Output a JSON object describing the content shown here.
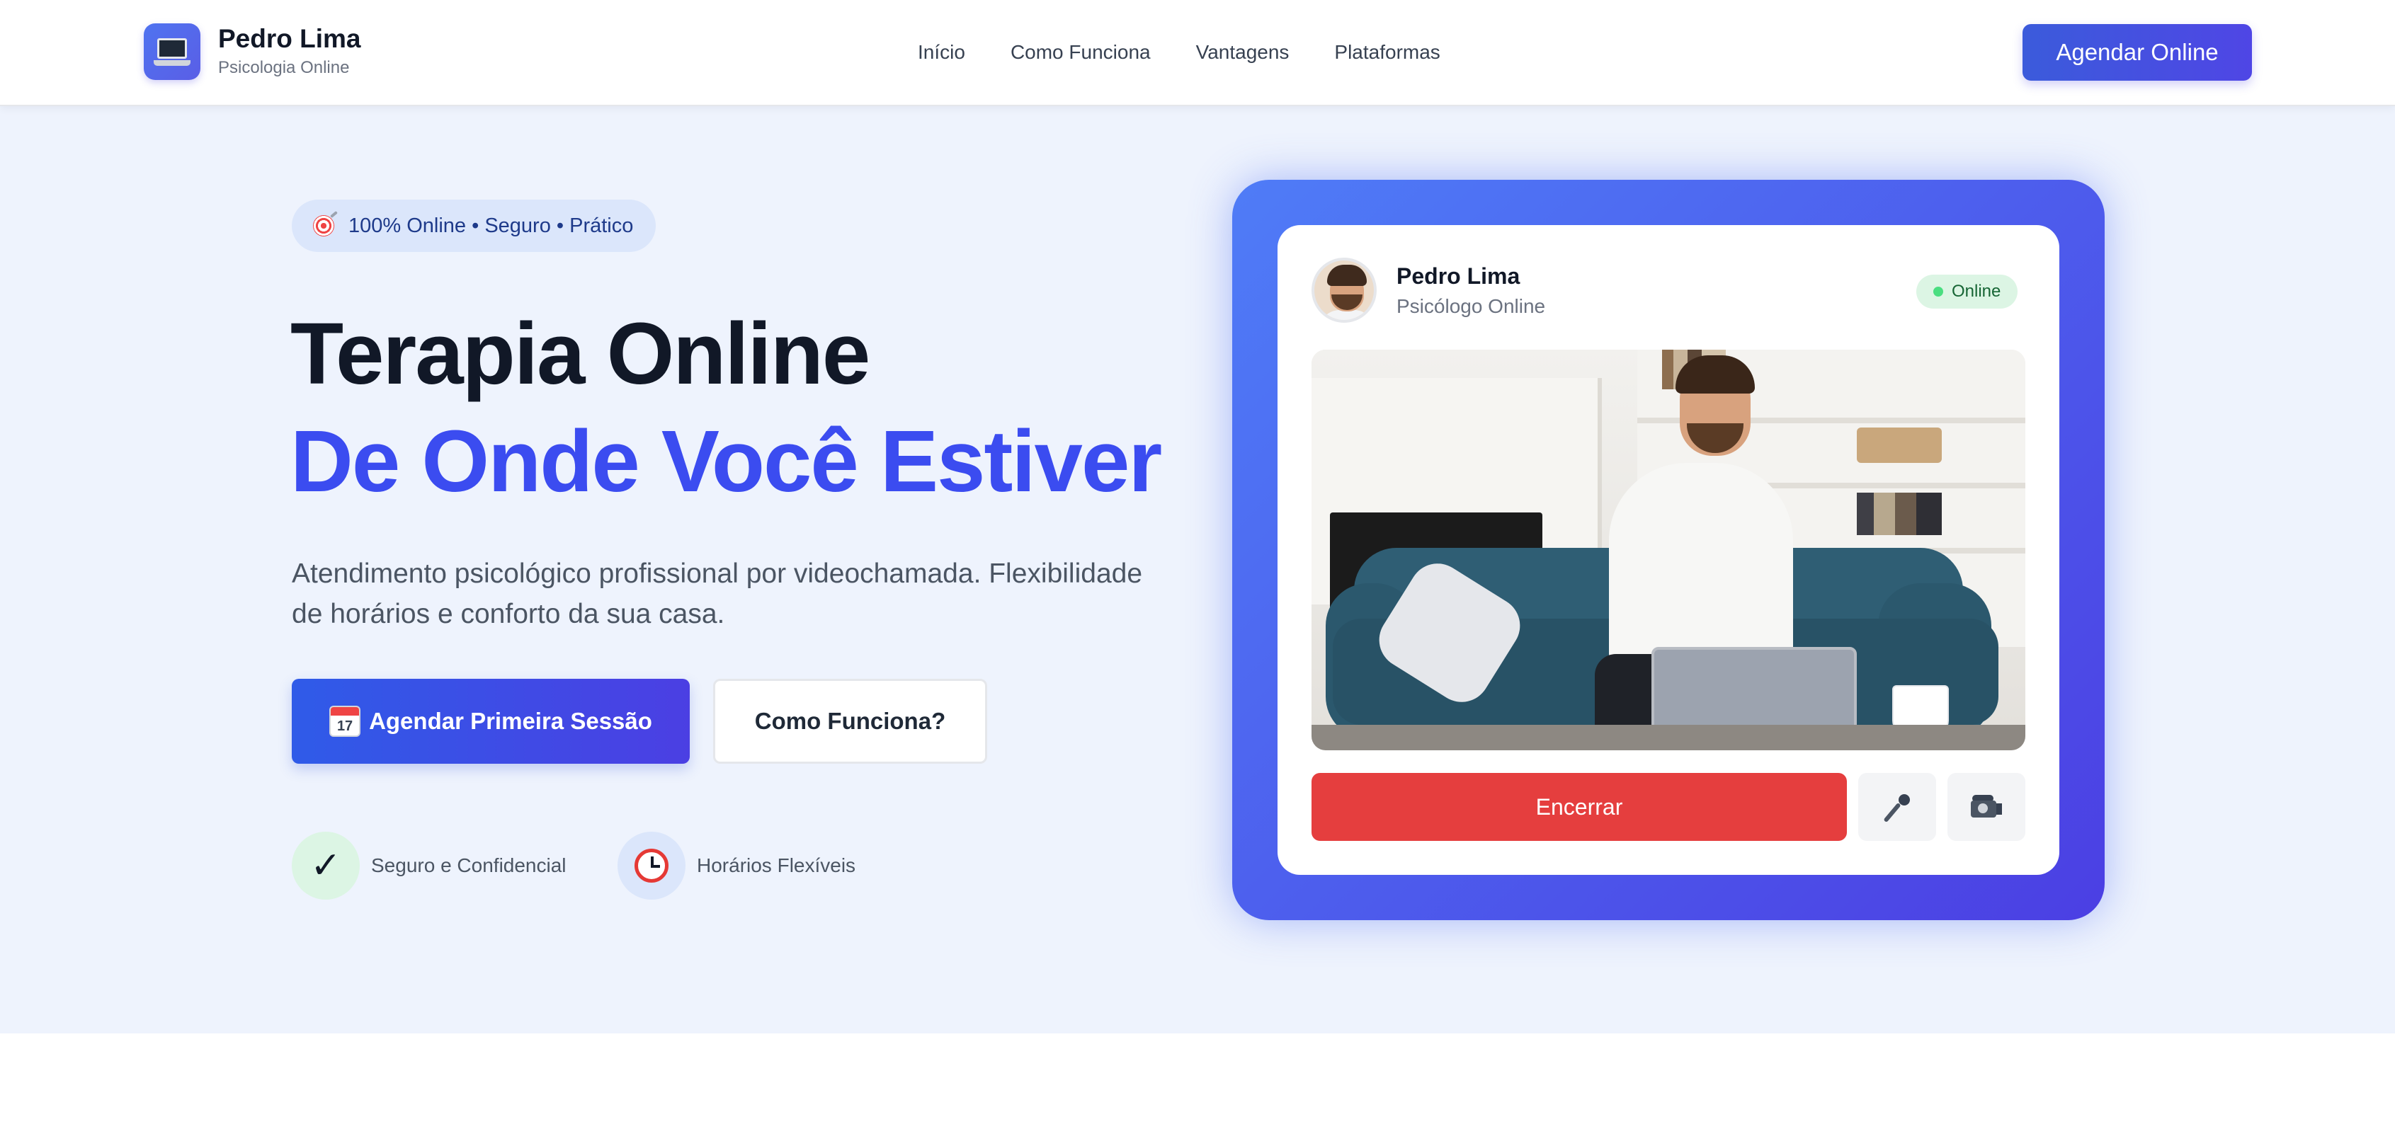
{
  "header": {
    "brand_name": "Pedro Lima",
    "brand_tagline": "Psicologia Online",
    "logo_icon": "laptop-icon",
    "nav": [
      {
        "label": "Início"
      },
      {
        "label": "Como Funciona"
      },
      {
        "label": "Vantagens"
      },
      {
        "label": "Plataformas"
      }
    ],
    "cta_label": "Agendar Online"
  },
  "hero": {
    "badge_icon": "target-icon",
    "badge_text": "100% Online • Seguro • Prático",
    "title_line1": "Terapia Online",
    "title_line2": "De Onde Você Estiver",
    "description": "Atendimento psicológico profissional por videochamada. Flexibilidade de horários e conforto da sua casa.",
    "primary_button": {
      "icon": "calendar-icon",
      "calendar_day": "17",
      "label": "Agendar Primeira Sessão"
    },
    "secondary_button": {
      "label": "Como Funciona?"
    },
    "features": [
      {
        "icon": "checkmark-icon",
        "label": "Seguro e Confidencial"
      },
      {
        "icon": "alarm-clock-icon",
        "label": "Horários Flexíveis"
      }
    ]
  },
  "video_call": {
    "name": "Pedro Lima",
    "role": "Psicólogo Online",
    "status": "Online",
    "end_button": "Encerrar",
    "controls": [
      {
        "icon": "microphone-icon"
      },
      {
        "icon": "video-camera-icon"
      }
    ]
  },
  "colors": {
    "accent": "#3b4cf0",
    "primary_gradient_start": "#2f5be8",
    "primary_gradient_end": "#4b3fe3",
    "hero_background": "#eef3fd",
    "end_call": "#e53e3e",
    "status_online": "#4ade80"
  }
}
